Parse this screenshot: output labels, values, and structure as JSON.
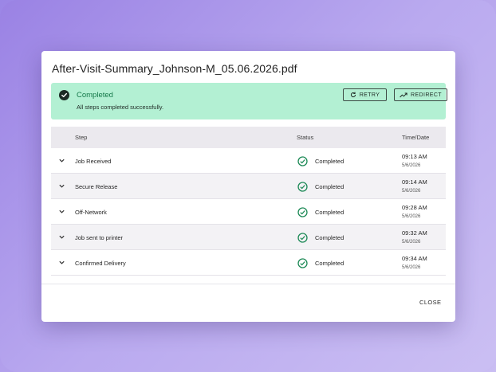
{
  "dialog": {
    "title": "After-Visit-Summary_Johnson-M_05.06.2026.pdf",
    "close_label": "CLOSE"
  },
  "banner": {
    "icon": "check-circle-icon",
    "title": "Completed",
    "subtitle": "All steps completed successfully.",
    "retry_label": "RETRY",
    "redirect_label": "REDIRECT",
    "bg_color": "#b3f0d3",
    "title_color": "#16794a"
  },
  "table": {
    "headers": {
      "step": "Step",
      "status": "Status",
      "time": "Time/Date"
    },
    "rows": [
      {
        "step": "Job Received",
        "status": "Completed",
        "time": "09:13 AM",
        "date": "5/6/2026"
      },
      {
        "step": "Secure Release",
        "status": "Completed",
        "time": "09:14 AM",
        "date": "5/6/2026"
      },
      {
        "step": "Off-Network",
        "status": "Completed",
        "time": "09:28 AM",
        "date": "5/6/2026"
      },
      {
        "step": "Job sent to printer",
        "status": "Completed",
        "time": "09:32 AM",
        "date": "5/6/2026"
      },
      {
        "step": "Confirmed Delivery",
        "status": "Completed",
        "time": "09:34 AM",
        "date": "5/6/2026"
      }
    ],
    "status_color": "#1e8a57"
  }
}
